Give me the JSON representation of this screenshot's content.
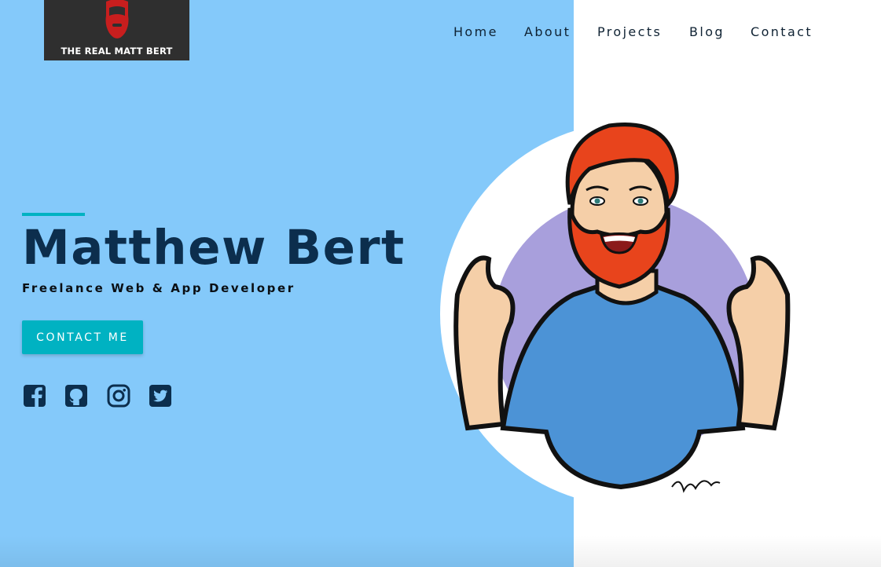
{
  "brand": {
    "logo_text": "THE REAL MATT BERT",
    "logo_bg": "#2f2f2f",
    "logo_accent": "#c81e1e"
  },
  "nav": {
    "items": [
      {
        "label": "Home"
      },
      {
        "label": "About"
      },
      {
        "label": "Projects"
      },
      {
        "label": "Blog"
      },
      {
        "label": "Contact"
      }
    ]
  },
  "hero": {
    "name": "Matthew Bert",
    "subtitle": "Freelance Web & App Developer",
    "cta_label": "CONTACT ME"
  },
  "socials": [
    {
      "icon": "facebook-icon"
    },
    {
      "icon": "github-icon"
    },
    {
      "icon": "instagram-icon"
    },
    {
      "icon": "twitter-icon"
    }
  ],
  "colors": {
    "left_panel": "#84c9fa",
    "accent": "#00b2c2",
    "heading": "#0c2e4d",
    "hair": "#e8441c",
    "shirt": "#4c93d6",
    "backdrop_circle": "#a89fdc"
  }
}
